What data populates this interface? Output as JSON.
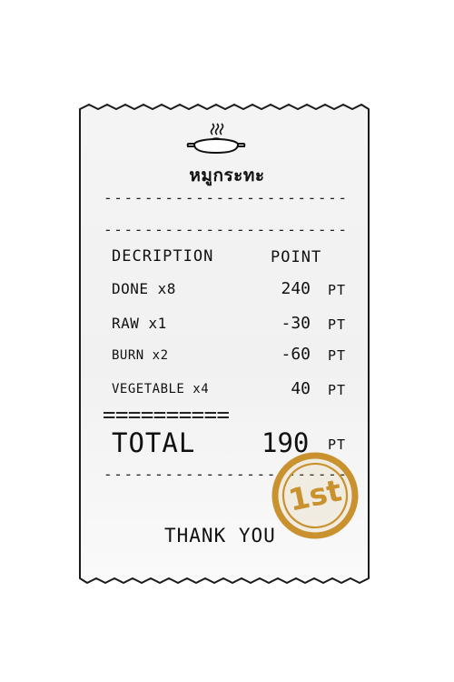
{
  "receipt": {
    "shop_name": "หมูกระทะ",
    "separator_dashes": "------------------------",
    "double_line": "==========",
    "header": {
      "description": "DECRIPTION",
      "point": "POINT"
    },
    "items": [
      {
        "label": "DONE x8",
        "value": "240",
        "unit": "PT"
      },
      {
        "label": "RAW x1",
        "value": "-30",
        "unit": "PT"
      },
      {
        "label": "BURN x2",
        "value": "-60",
        "unit": "PT"
      },
      {
        "label": "VEGETABLE x4",
        "value": "40",
        "unit": "PT"
      }
    ],
    "total": {
      "label": "TOTAL",
      "value": "190",
      "unit": "PT"
    },
    "thank_you": "THANK YOU",
    "stamp_text": "1st"
  },
  "colors": {
    "paper": "#f3f3f3",
    "ink": "#111111",
    "stamp": "#c9922e"
  },
  "icons": {
    "logo": "grill-pan-icon"
  }
}
